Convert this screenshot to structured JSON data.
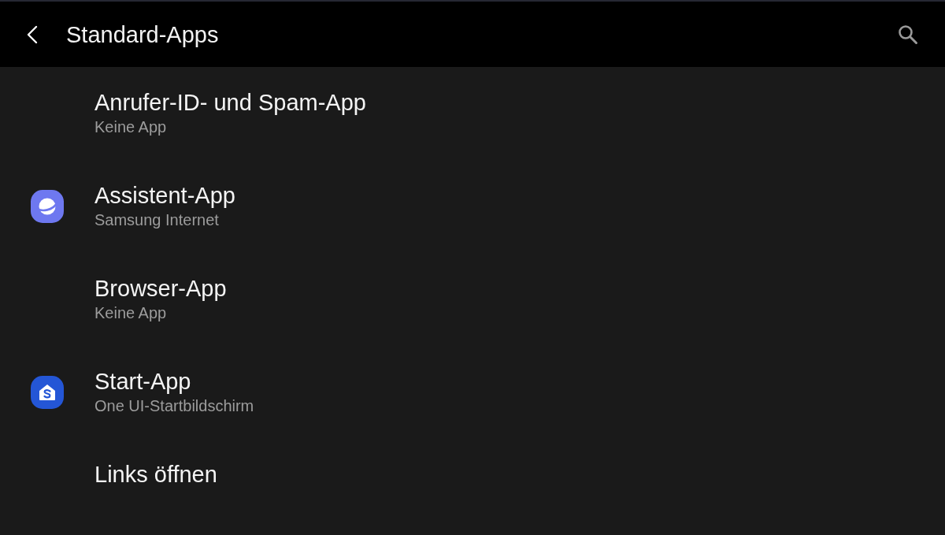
{
  "header": {
    "title": "Standard-Apps"
  },
  "items": [
    {
      "kind": "plain",
      "title": "Anrufer-ID- und Spam-App",
      "subtitle": "Keine App"
    },
    {
      "kind": "browser-app",
      "title": "Assistent-App",
      "subtitle": "Samsung Internet"
    },
    {
      "kind": "plain",
      "title": "Browser-App",
      "subtitle": "Keine App"
    },
    {
      "kind": "launcher-app",
      "title": "Start-App",
      "subtitle": "One UI-Startbildschirm"
    },
    {
      "kind": "plain",
      "title": "Links öffnen"
    }
  ]
}
